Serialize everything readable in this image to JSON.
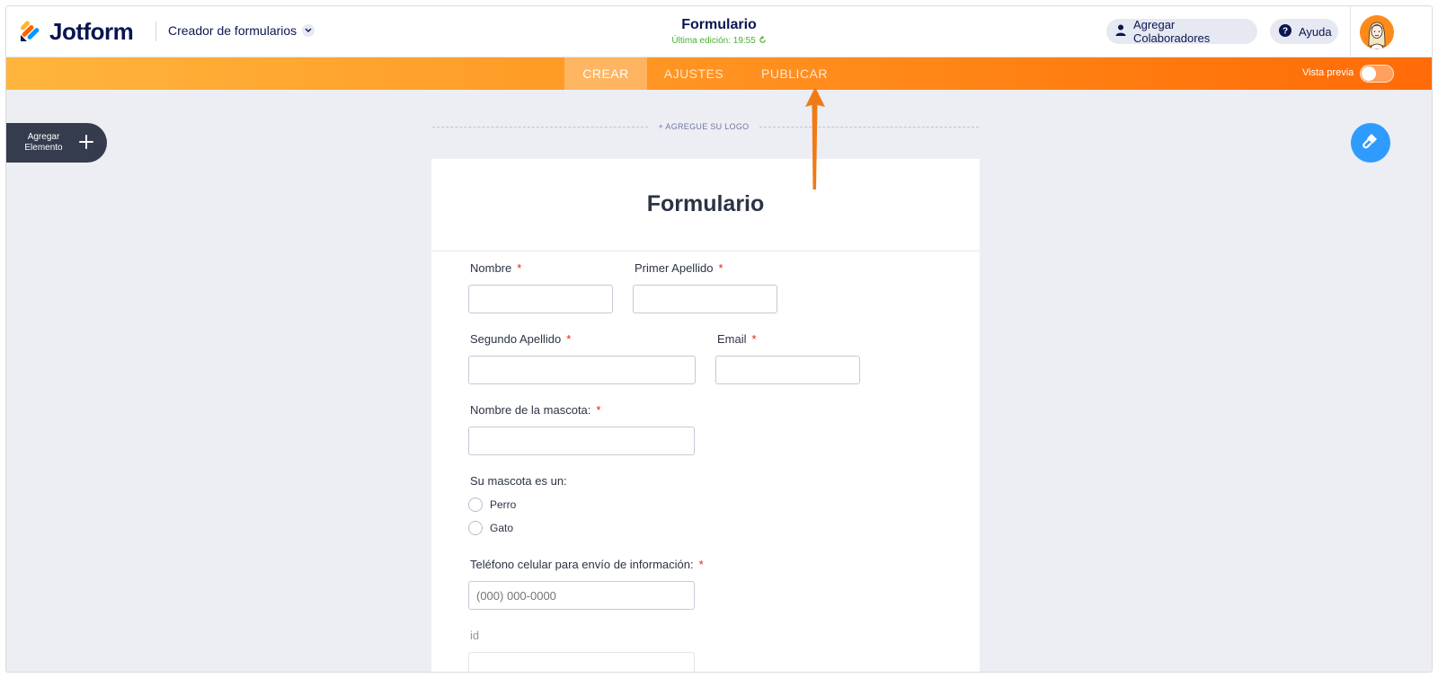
{
  "app": {
    "brand": "Jotform",
    "builder_label": "Creador de formularios"
  },
  "header": {
    "form_title": "Formulario",
    "last_edit": "Última edición: 19:55",
    "collaborators_label": "Agregar Colaboradores",
    "help_label": "Ayuda"
  },
  "nav": {
    "tabs": [
      {
        "label": "CREAR",
        "active": true
      },
      {
        "label": "AJUSTES",
        "active": false
      },
      {
        "label": "PUBLICAR",
        "active": false
      }
    ],
    "preview_label": "Vista previa",
    "preview_on": false
  },
  "sidebar": {
    "add_element_line1": "Agregar",
    "add_element_line2": "Elemento"
  },
  "canvas": {
    "add_logo": "+ AGREGUE SU LOGO"
  },
  "form": {
    "title": "Formulario",
    "fields": {
      "nombre": {
        "label": "Nombre",
        "required": "*"
      },
      "primer_apellido": {
        "label": "Primer Apellido",
        "required": "*"
      },
      "segundo_apellido": {
        "label": "Segundo Apellido",
        "required": "*"
      },
      "email": {
        "label": "Email",
        "required": "*"
      },
      "mascota_nombre": {
        "label": "Nombre de la mascota:",
        "required": "*"
      },
      "mascota_tipo": {
        "label": "Su mascota es un:",
        "options": [
          "Perro",
          "Gato"
        ]
      },
      "telefono": {
        "label": "Teléfono celular para envío de información:",
        "required": "*",
        "placeholder": "(000) 000-0000"
      },
      "id": {
        "label": "id"
      }
    }
  },
  "colors": {
    "brand_navy": "#0a1551",
    "nav_orange_start": "#ffb53d",
    "nav_orange_end": "#ff6b08",
    "required_red": "#e3250e",
    "fab_blue": "#2f9bff",
    "edit_green": "#4caf32"
  }
}
